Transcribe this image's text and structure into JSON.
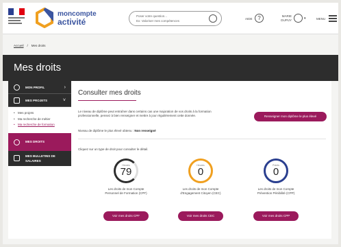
{
  "header": {
    "logo_line1": "moncompte",
    "logo_line2": "activité",
    "search_placeholder_1": "Poser votre question...",
    "search_placeholder_2": "Ex: Valoriser mes compétences",
    "aide_label": "AIDE",
    "user_label_1": "MARIE",
    "user_label_2": "DUPUY",
    "menu_label": "MENU"
  },
  "breadcrumb": {
    "home": "Accueil",
    "sep": "/",
    "current": "Mes droits"
  },
  "band": {
    "title": "Mes droits"
  },
  "sidebar": {
    "profil": "MON PROFIL",
    "projets": "MES PROJETS",
    "sub": [
      "Mes projets",
      "Ma recherche de métier",
      "Ma recherche de formation"
    ],
    "droits": "MES DROITS",
    "bulletins_1": "MES BULLETINS DE",
    "bulletins_2": "SALAIRES"
  },
  "main": {
    "title": "Consulter mes droits",
    "intro": "Le niveau de diplôme peut entraîner dans certains cas une majoration de vos droits à la formation professionnelle, pensez à bien renseigner et mettre à jour régulièrement cette donnée.",
    "niveau_label": "Niveau de diplôme le plus élevé obtenu :",
    "niveau_value": "Non renseigné",
    "renseigner_button": "Renseigner mon diplôme le plus élevé",
    "clic": "Cliquez sur un type de droit pour consulter le détail.",
    "dials": [
      {
        "small": "Heures",
        "value": "79",
        "cap1": "Les droits de mon Compte",
        "cap2": "Personnel de Formation (CPF)",
        "button": "Voir mes droits CPF",
        "color": "#2d2d2d"
      },
      {
        "small": "Heures",
        "value": "0",
        "cap1": "Les droits de mon Compte",
        "cap2": "d'Engagement Citoyen (CEC)",
        "button": "Voir mes droits CEC",
        "color": "#f0a020"
      },
      {
        "small": "Points",
        "value": "0",
        "cap1": "Les droits de mon Compte",
        "cap2": "Prévention Pénibilité (CPP)",
        "button": "Voir mes droits CPP",
        "color": "#2a3f8f"
      }
    ]
  },
  "colors": {
    "accent": "#9b1a5c",
    "dark": "#2d2d2d",
    "brand_blue": "#3b55a0"
  },
  "icons": [
    "hamburger-menu-icon",
    "search-icon",
    "help-icon",
    "user-icon",
    "profile-icon",
    "projects-icon",
    "rights-icon",
    "payslip-icon"
  ]
}
